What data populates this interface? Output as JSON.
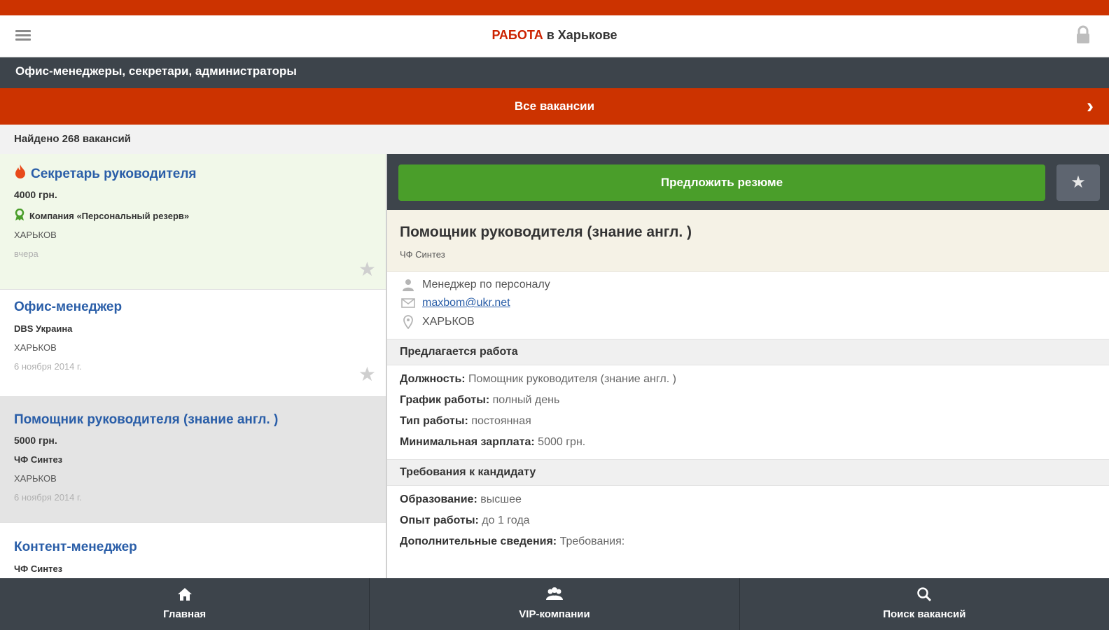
{
  "colors": {
    "accent": "#cc3300",
    "dark": "#3d444b",
    "green": "#4a9e2a",
    "link": "#2a5ea8"
  },
  "app": {
    "title_accent": "РАБОТА",
    "title_rest": " в Харькове"
  },
  "category": "Офис-менеджеры, секретари, администраторы",
  "all_vacancies_label": "Все вакансии",
  "found_label": "Найдено 268 вакансий",
  "jobs": [
    {
      "title": "Секретарь руководителя",
      "salary": "4000 грн.",
      "company": "Компания «Персональный резерв»",
      "city": "ХАРЬКОВ",
      "date": "вчера",
      "hot": true,
      "featured_company": true
    },
    {
      "title": "Офис-менеджер",
      "company": "DBS Украина",
      "city": "ХАРЬКОВ",
      "date": "6 ноября 2014 г."
    },
    {
      "title": "Помощник руководителя (знание англ. )",
      "salary": "5000 грн.",
      "company": "ЧФ Синтез",
      "city": "ХАРЬКОВ",
      "date": "6 ноября 2014 г.",
      "selected": true
    },
    {
      "title": "Контент-менеджер",
      "company": "ЧФ Синтез"
    }
  ],
  "detail": {
    "apply_label": "Предложить резюме",
    "title": "Помощник руководителя (знание англ. )",
    "company": "ЧФ Синтез",
    "contact_person": "Менеджер по персоналу",
    "email": "maxbom@ukr.net",
    "city": "ХАРЬКОВ",
    "section_offer": "Предлагается работа",
    "offer_fields": [
      {
        "label": "Должность:",
        "value": " Помощник руководителя (знание англ. )"
      },
      {
        "label": "График работы:",
        "value": " полный день"
      },
      {
        "label": "Тип работы:",
        "value": " постоянная"
      },
      {
        "label": "Минимальная зарплата:",
        "value": " 5000 грн."
      }
    ],
    "section_requirements": "Требования к кандидату",
    "req_fields": [
      {
        "label": "Образование:",
        "value": " высшее"
      },
      {
        "label": "Опыт работы:",
        "value": " до 1 года"
      },
      {
        "label": "Дополнительные сведения:",
        "value": " Требования:"
      }
    ]
  },
  "bottom_nav": [
    {
      "label": "Главная",
      "icon": "home-icon"
    },
    {
      "label": "VIP-компании",
      "icon": "group-icon"
    },
    {
      "label": "Поиск вакансий",
      "icon": "search-icon"
    }
  ]
}
